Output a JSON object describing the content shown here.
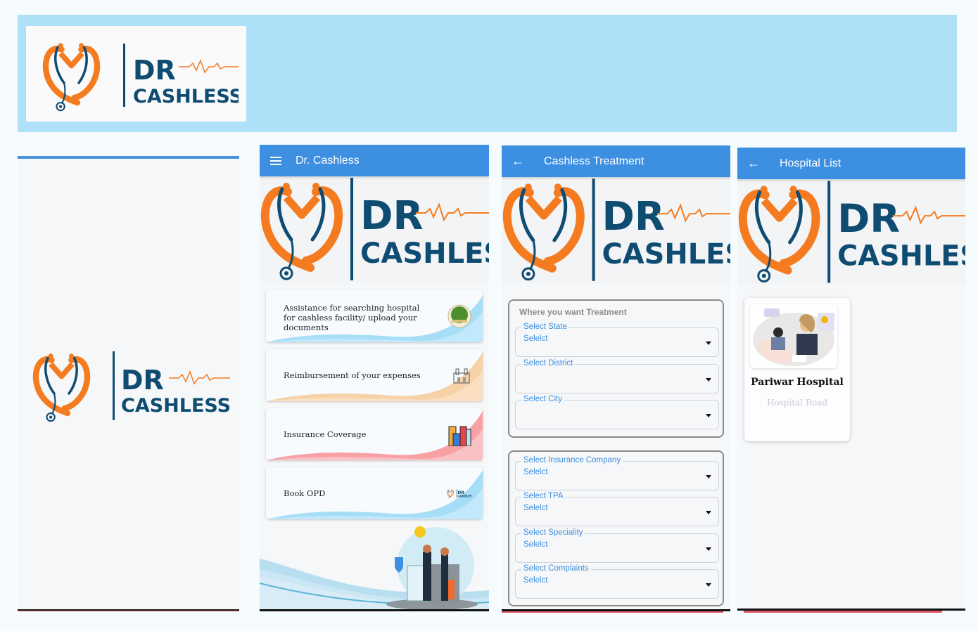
{
  "banner": {
    "logo": {
      "line1": "DR",
      "line2": "CASHLESS"
    }
  },
  "brand": {
    "orange": "#f47b20",
    "navy": "#0f4c72",
    "appbar_blue": "#3d8fe2",
    "banner_blue": "#aee1f8"
  },
  "screens": {
    "splash": {
      "logo": {
        "line1": "DR",
        "line2": "CASHLESS"
      }
    },
    "home": {
      "appbar": {
        "menu_icon": "hamburger-menu-icon",
        "title": "Dr. Cashless"
      },
      "hero_logo": {
        "line1": "DR",
        "line2": "CASHLESS"
      },
      "menu_items": [
        {
          "label_lines": [
            "Assistance for searching hospital",
            "for  cashless facility/ upload your",
            "documents"
          ],
          "icon": "hospital-seal-icon",
          "wave_color": "#a6def8"
        },
        {
          "label_lines": [
            "Reimbursement of your expenses"
          ],
          "icon": "building-icon",
          "wave_color": "#f7d2a8"
        },
        {
          "label_lines": [
            "Insurance Coverage"
          ],
          "icon": "city-buildings-icon",
          "wave_color": "#f7a1a5"
        },
        {
          "label_lines": [
            "Book OPD"
          ],
          "icon": "dr-cashless-logo-icon",
          "wave_color": "#a6def8"
        }
      ],
      "footer_illustration": "family-healthcare-illustration"
    },
    "cashless_treatment": {
      "appbar": {
        "back_icon": "arrow-left-icon",
        "title": "Cashless Treatment"
      },
      "hero_logo": {
        "line1": "DR",
        "line2": "CASHLESS"
      },
      "location_group": {
        "title": "Where you want Treatment",
        "fields": [
          {
            "label": "Select State",
            "value": "Selelct"
          },
          {
            "label": "Select District",
            "value": ""
          },
          {
            "label": "Select City",
            "value": ""
          }
        ]
      },
      "details_group": {
        "fields": [
          {
            "label": "Select Insurance Company",
            "value": "Selelct"
          },
          {
            "label": "Select TPA",
            "value": "Selelct"
          },
          {
            "label": "Select Speciality",
            "value": "Selelct"
          },
          {
            "label": "Select Complaints",
            "value": "Selelct"
          }
        ]
      }
    },
    "hospital_list": {
      "appbar": {
        "back_icon": "arrow-left-icon",
        "title": "Hospital List"
      },
      "hero_logo": {
        "line1": "DR",
        "line2": "CASHLESS"
      },
      "hospitals": [
        {
          "name": "Pariwar Hospital",
          "address": "Hospital Road"
        }
      ]
    }
  }
}
